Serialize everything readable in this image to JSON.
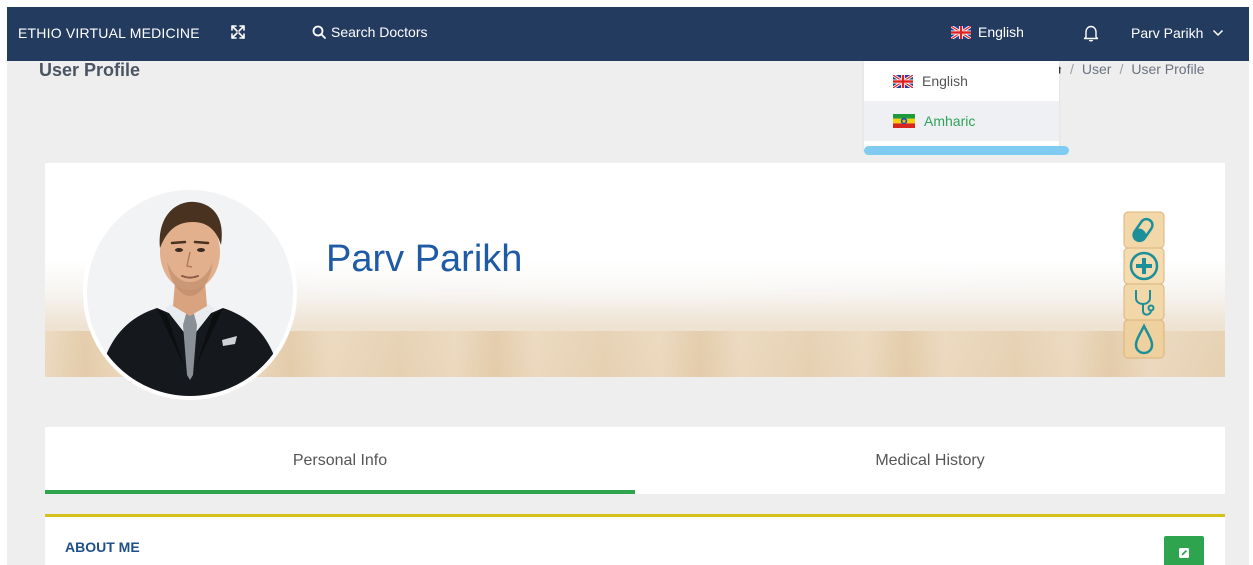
{
  "navbar": {
    "brand": "ETHIO VIRTUAL MEDICINE",
    "search_label": "Search Doctors",
    "language": "English",
    "user_name": "Parv Parikh"
  },
  "language_dropdown": {
    "items": [
      {
        "label": "English",
        "flag": "uk-flag-icon"
      },
      {
        "label": "Amharic",
        "flag": "ethiopia-flag-icon"
      }
    ]
  },
  "page": {
    "title": "User Profile",
    "breadcrumb": [
      "User",
      "User Profile"
    ]
  },
  "profile": {
    "name": "Parv Parikh"
  },
  "tabs": [
    {
      "label": "Personal Info",
      "active": true
    },
    {
      "label": "Medical History",
      "active": false
    }
  ],
  "about": {
    "title": "ABOUT ME"
  },
  "colors": {
    "navbar": "#243b60",
    "accent_green": "#2ea44f",
    "about_border": "#d4c21a",
    "name_blue": "#1f5aa6"
  }
}
